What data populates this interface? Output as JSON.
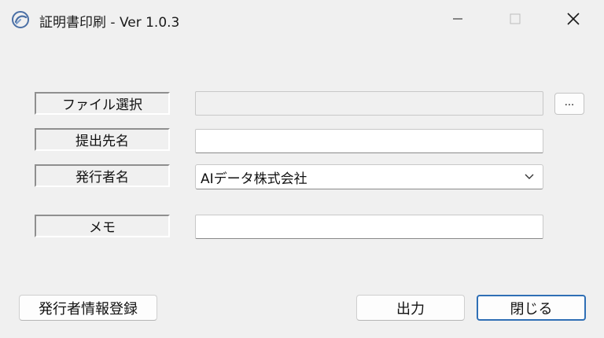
{
  "window": {
    "title": "証明書印刷 - Ver 1.0.3"
  },
  "form": {
    "file_select_label": "ファイル選択",
    "file_select_value": "",
    "browse_label": "...",
    "recipient_label": "提出先名",
    "recipient_value": "",
    "issuer_label": "発行者名",
    "issuer_selected": "AIデータ株式会社",
    "memo_label": "メモ",
    "memo_value": ""
  },
  "buttons": {
    "register_issuer": "発行者情報登録",
    "output": "出力",
    "close": "閉じる"
  },
  "icons": {
    "app": "app-logo-icon",
    "minimize": "minimize-icon",
    "maximize": "maximize-icon",
    "close": "close-icon",
    "dropdown": "chevron-down-icon"
  }
}
